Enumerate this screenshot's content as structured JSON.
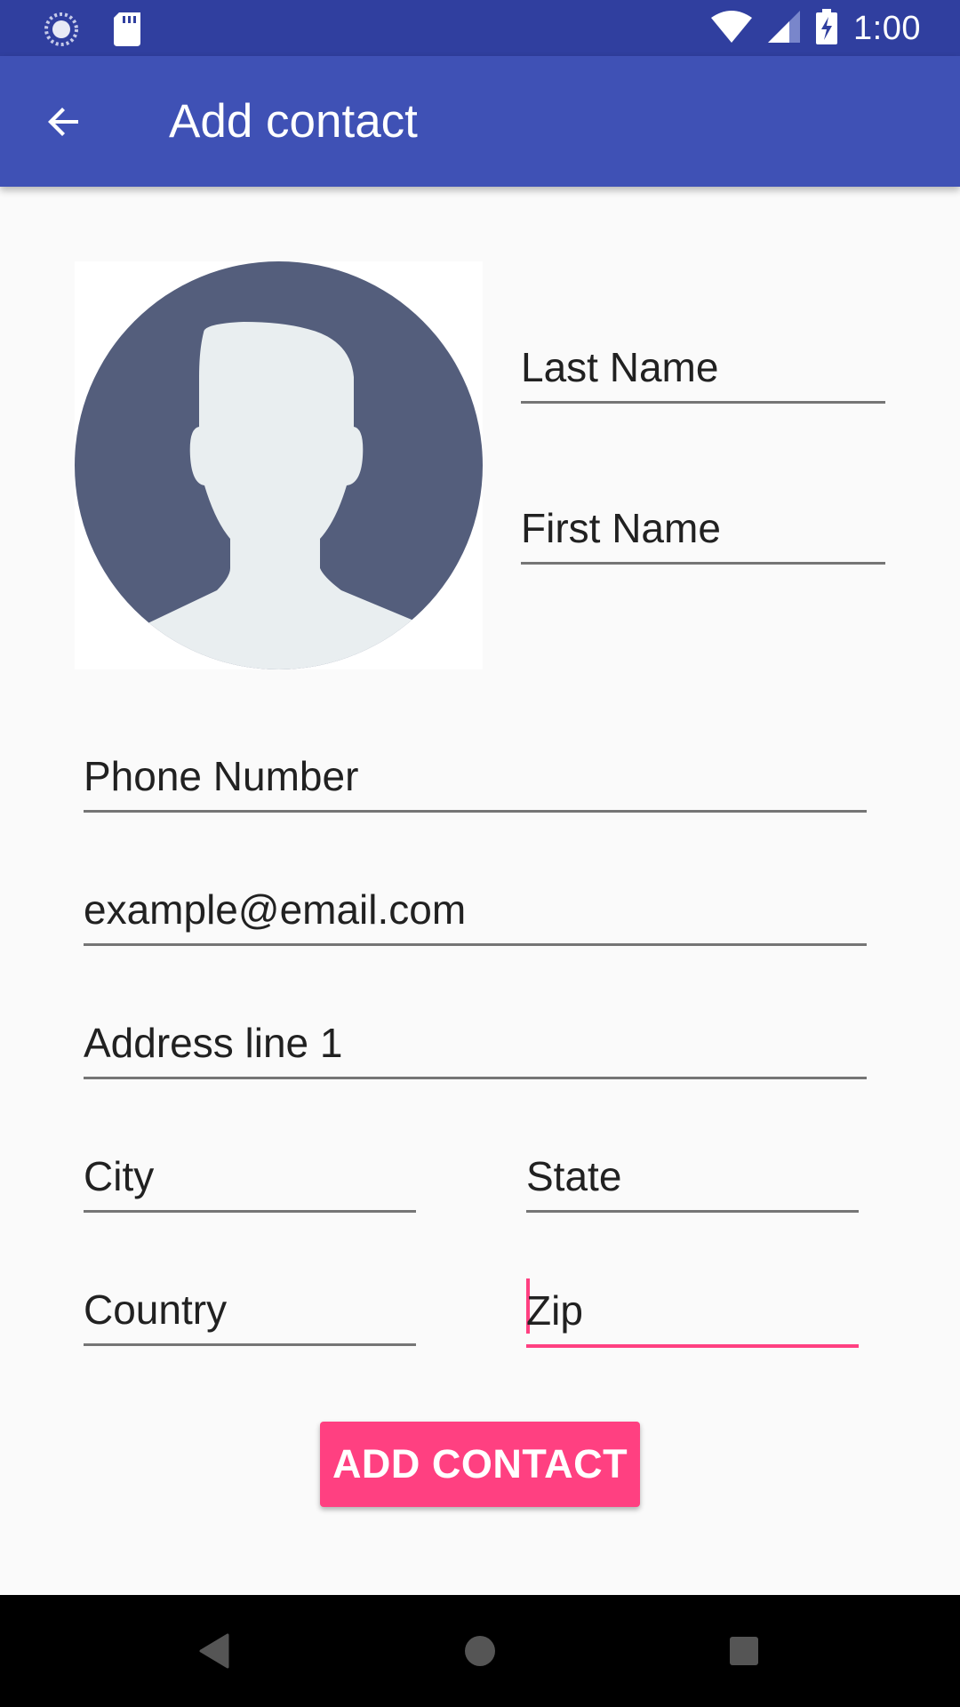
{
  "status_bar": {
    "time": "1:00",
    "icons": [
      "spinner-icon",
      "sd-card-icon",
      "wifi-icon",
      "signal-icon",
      "battery-charging-icon"
    ]
  },
  "app_bar": {
    "title": "Add contact",
    "back_icon": "arrow-back-icon",
    "color": "#3f51b5"
  },
  "avatar": {
    "icon": "person-placeholder-icon",
    "circle_color": "#545e7c",
    "figure_color": "#e9eef0"
  },
  "form": {
    "last_name": "Last Name",
    "first_name": "First Name",
    "phone": "Phone Number",
    "email": "example@email.com",
    "address1": "Address line 1",
    "city": "City",
    "state": "State",
    "country": "Country",
    "zip": "Zip"
  },
  "actions": {
    "add_contact": "ADD CONTACT",
    "accent": "#ff4081"
  },
  "nav_bar": {
    "back": "back-icon",
    "home": "home-icon",
    "recents": "recents-icon"
  }
}
